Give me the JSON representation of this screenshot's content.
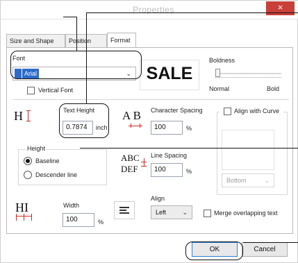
{
  "window": {
    "title": "Properties",
    "close_symbol": "×",
    "close_color": "#c9403b"
  },
  "tabs": [
    {
      "label": "Size and Shape",
      "active": false
    },
    {
      "label": "Position",
      "active": false
    },
    {
      "label": "Format",
      "active": true
    }
  ],
  "font": {
    "label": "Font",
    "value": "Arial",
    "vertical_label": "Vertical Font",
    "vertical_checked": false
  },
  "preview": {
    "text": "SALE"
  },
  "boldness": {
    "label": "Boldness",
    "min_label": "Normal",
    "max_label": "Bold",
    "level": 0
  },
  "text_height": {
    "label": "Text Height",
    "value": "0.7874",
    "unit": "inch"
  },
  "char_spacing": {
    "label": "Character Spacing",
    "value": "100",
    "unit": "%"
  },
  "align_curve": {
    "label": "Align with Curve",
    "checked": false,
    "select_value": "Bottom"
  },
  "height_group": {
    "legend": "Height",
    "options": [
      {
        "label": "Baseline",
        "selected": true
      },
      {
        "label": "Descender line",
        "selected": false
      }
    ]
  },
  "line_spacing": {
    "label": "Line Spacing",
    "value": "100",
    "unit": "%"
  },
  "width": {
    "label": "Width",
    "value": "100",
    "unit": "%"
  },
  "align": {
    "label": "Align",
    "value": "Left"
  },
  "merge": {
    "label": "Merge overlapping text",
    "checked": false
  },
  "buttons": {
    "ok": "OK",
    "cancel": "Cancel"
  },
  "icons": {
    "text_height_icon": "H",
    "char_spacing_icon": "A B",
    "line_spacing_icon_top": "ABC",
    "line_spacing_icon_bottom": "DEF",
    "width_icon": "HI"
  },
  "accent_color": "#cc2a2a"
}
